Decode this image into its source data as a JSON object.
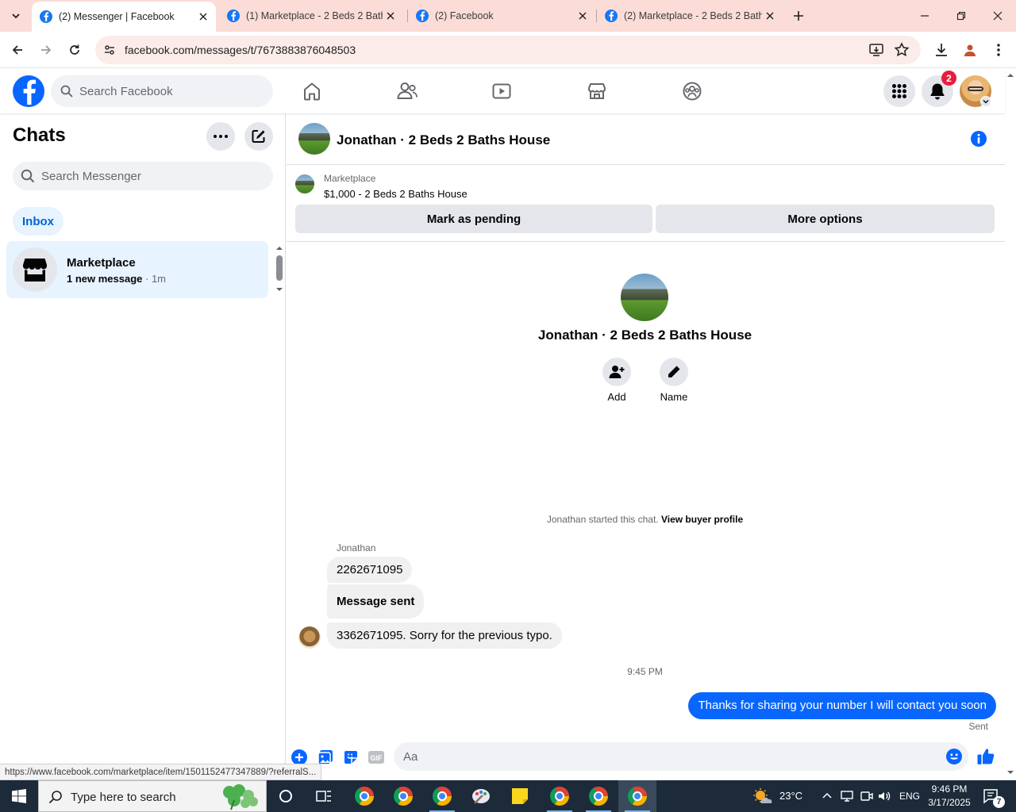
{
  "browser": {
    "tabs": [
      {
        "title": "(2) Messenger | Facebook",
        "active": true
      },
      {
        "title": "(1) Marketplace - 2 Beds 2 Bath",
        "active": false
      },
      {
        "title": "(2) Facebook",
        "active": false
      },
      {
        "title": "(2) Marketplace - 2 Beds 2 Bath",
        "active": false
      }
    ],
    "url": "facebook.com/messages/t/7673883876048503",
    "status_url": "https://www.facebook.com/marketplace/item/1501152477347889/?referralS..."
  },
  "fb_header": {
    "search_placeholder": "Search Facebook",
    "notification_count": "2"
  },
  "sidebar": {
    "title": "Chats",
    "search_placeholder": "Search Messenger",
    "filter_label": "Inbox",
    "chats": [
      {
        "name": "Marketplace",
        "unread_text": "1 new message",
        "separator": " · ",
        "time": "1m"
      }
    ]
  },
  "conversation": {
    "title": "Jonathan · 2 Beds 2 Baths House",
    "listing": {
      "label": "Marketplace",
      "price_title": "$1,000 - 2 Beds 2 Baths House",
      "mark_pending_label": "Mark as pending",
      "more_options_label": "More options"
    },
    "profile": {
      "name": "Jonathan · 2 Beds 2 Baths House",
      "actions": [
        {
          "label": "Add"
        },
        {
          "label": "Name"
        }
      ]
    },
    "started_text": "Jonathan started this chat. ",
    "buyer_profile_link": "View buyer profile",
    "sender_name": "Jonathan",
    "incoming_messages": [
      "2262671095",
      "Message sent",
      "3362671095. Sorry for the previous typo."
    ],
    "timestamp": "9:45 PM",
    "outgoing_message": "Thanks for sharing your number I will contact you soon",
    "sent_status": "Sent",
    "composer_placeholder": "Aa"
  },
  "taskbar": {
    "search_placeholder": "Type here to search",
    "weather": "23°C",
    "language": "ENG",
    "time": "9:46 PM",
    "date": "3/17/2025",
    "notification_count": "7"
  },
  "colors": {
    "fb_blue": "#0866ff",
    "tab_bar": "#fbdcd7",
    "outgoing_bubble": "#0866ff",
    "incoming_bubble": "#f0f0f0",
    "badge_red": "#e41e3f"
  }
}
